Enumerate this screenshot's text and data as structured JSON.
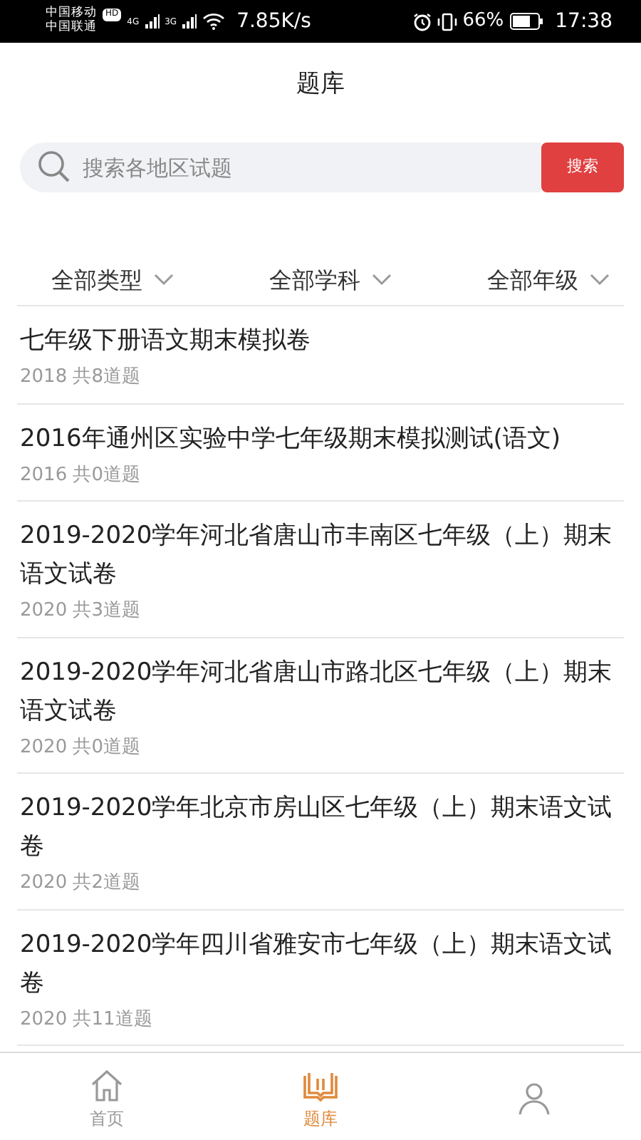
{
  "status_bar": {
    "carrier_1": "中国移动",
    "hd": "HD",
    "carrier_2": "中国联通",
    "net_1": "4G",
    "net_2": "3G",
    "speed": "7.85K/s",
    "battery": "66%",
    "time": "17:38"
  },
  "header": {
    "title": "题库"
  },
  "search": {
    "placeholder": "搜索各地区试题",
    "button": "搜索"
  },
  "filters": [
    {
      "label": "全部类型"
    },
    {
      "label": "全部学科"
    },
    {
      "label": "全部年级"
    }
  ],
  "papers": [
    {
      "title": "七年级下册语文期末模拟卷",
      "meta": "2018 共8道题"
    },
    {
      "title": "2016年通州区实验中学七年级期末模拟测试(语文)",
      "meta": "2016 共0道题"
    },
    {
      "title": "2019-2020学年河北省唐山市丰南区七年级（上）期末语文试卷",
      "meta": "2020 共3道题"
    },
    {
      "title": "2019-2020学年河北省唐山市路北区七年级（上）期末语文试卷",
      "meta": "2020 共0道题"
    },
    {
      "title": "2019-2020学年北京市房山区七年级（上）期末语文试卷",
      "meta": "2020 共2道题"
    },
    {
      "title": "2019-2020学年四川省雅安市七年级（上）期末语文试卷",
      "meta": "2020 共11道题"
    }
  ],
  "tab_bar": [
    {
      "kind": "home",
      "label": "首页",
      "selected": false
    },
    {
      "kind": "book",
      "label": "题库",
      "selected": true
    },
    {
      "kind": "person",
      "selected": false
    }
  ]
}
